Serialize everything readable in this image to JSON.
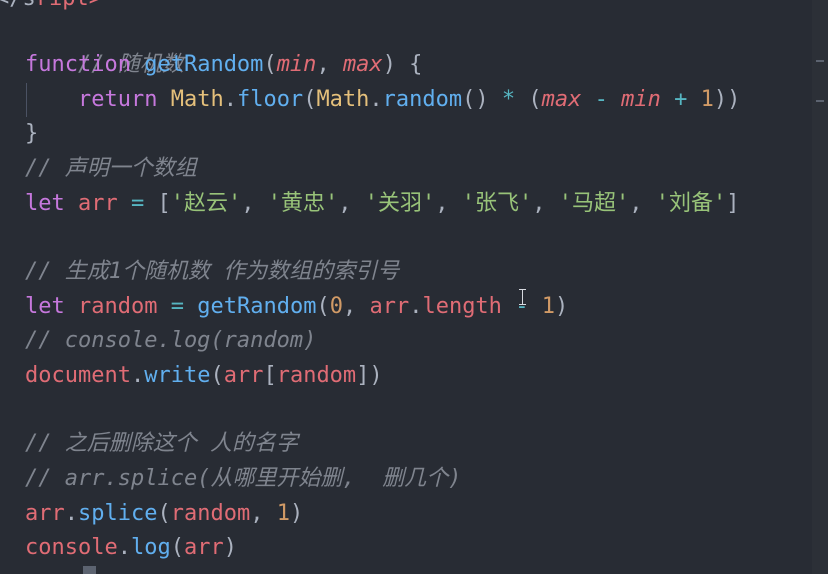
{
  "top_fragment": "ript>",
  "lines": {
    "l1": {
      "comment": "// 随机数"
    },
    "l2": {
      "kw": "function",
      "fn": "getRandom",
      "p1": "min",
      "p2": "max"
    },
    "l3": {
      "kw": "return",
      "cls1": "Math",
      "m1": "floor",
      "cls2": "Math",
      "m2": "random",
      "op": "*",
      "v1": "max",
      "minus": "-",
      "v2": "min",
      "plus": "+",
      "num": "1"
    },
    "l4": {
      "brace": "}"
    },
    "l5": {
      "comment": "// 声明一个数组"
    },
    "l6": {
      "kw": "let",
      "var": "arr",
      "op": "=",
      "items": [
        "'赵云'",
        "'黄忠'",
        "'关羽'",
        "'张飞'",
        "'马超'",
        "'刘备'"
      ]
    },
    "l8": {
      "comment": "// 生成1个随机数 作为数组的索引号"
    },
    "l9": {
      "kw": "let",
      "var": "random",
      "op": "=",
      "fn": "getRandom",
      "n0": "0",
      "obj": "arr",
      "prop": "length",
      "minus": "-",
      "n1": "1"
    },
    "l10": {
      "comment": "// console.log(random)"
    },
    "l11": {
      "obj": "document",
      "fn": "write",
      "arr": "arr",
      "idx": "random"
    },
    "l13": {
      "comment": "// 之后删除这个 人的名字"
    },
    "l14": {
      "comment": "// arr.splice(从哪里开始删,  删几个)"
    },
    "l15": {
      "obj": "arr",
      "fn": "splice",
      "arg": "random",
      "num": "1"
    },
    "l16": {
      "obj": "console",
      "fn": "log",
      "arg": "arr"
    }
  }
}
